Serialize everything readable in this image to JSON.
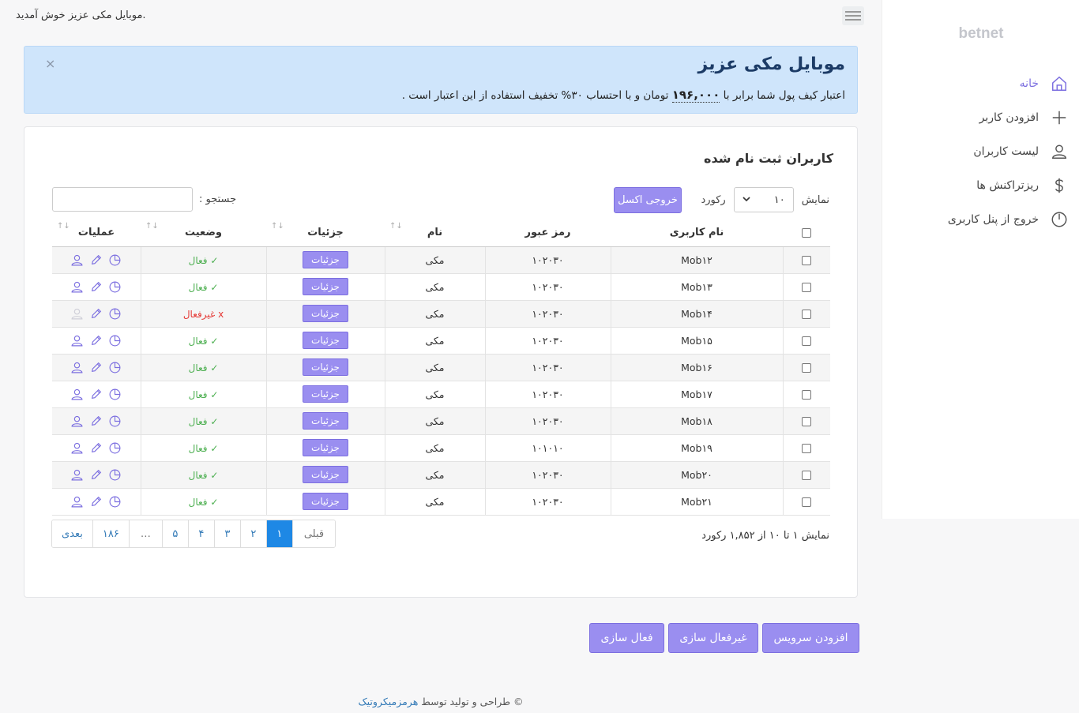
{
  "header": {
    "welcome": "موبایل مکی عزیز خوش آمدید."
  },
  "sidebar": {
    "brand": "betnet",
    "items": [
      {
        "label": "خانه",
        "icon": "home-icon"
      },
      {
        "label": "افزودن کاربر",
        "icon": "plus-icon"
      },
      {
        "label": "لیست کاربران",
        "icon": "user-icon"
      },
      {
        "label": "ریزتراکنش ها",
        "icon": "dollar-icon"
      },
      {
        "label": "خروج از پنل کاربری",
        "icon": "power-icon"
      }
    ]
  },
  "alert": {
    "title": "موبایل مکی عزیز",
    "text_before": "اعتبار کیف پول شما برابر با",
    "amount": "۱۹۶,۰۰۰",
    "text_after": "تومان و با احتساب ۳۰% تخفیف استفاده از این اعتبار است .",
    "close": "×"
  },
  "card": {
    "title": "کاربران ثبت نام شده",
    "show_label": "نمایش",
    "page_size": "۱۰",
    "records_label": "رکورد",
    "excel_label": "خروجی اکسل",
    "search_label": "جستجو :",
    "search_value": ""
  },
  "table": {
    "headers": {
      "username": "نام کاربری",
      "password": "رمز عبور",
      "name": "نام",
      "details": "جزئیات",
      "status": "وضعیت",
      "operations": "عملیات",
      "sort": "↓↑"
    },
    "detail_label": "جزئیات",
    "rows": [
      {
        "username": "Mob۱۲",
        "password": "۱۰۲۰۳۰",
        "name": "مکی",
        "status": "✓ فعال",
        "active": true
      },
      {
        "username": "Mob۱۳",
        "password": "۱۰۲۰۳۰",
        "name": "مکی",
        "status": "✓ فعال",
        "active": true
      },
      {
        "username": "Mob۱۴",
        "password": "۱۰۲۰۳۰",
        "name": "مکی",
        "status": "x غیرفعال",
        "active": false
      },
      {
        "username": "Mob۱۵",
        "password": "۱۰۲۰۳۰",
        "name": "مکی",
        "status": "✓ فعال",
        "active": true
      },
      {
        "username": "Mob۱۶",
        "password": "۱۰۲۰۳۰",
        "name": "مکی",
        "status": "✓ فعال",
        "active": true
      },
      {
        "username": "Mob۱۷",
        "password": "۱۰۲۰۳۰",
        "name": "مکی",
        "status": "✓ فعال",
        "active": true
      },
      {
        "username": "Mob۱۸",
        "password": "۱۰۲۰۳۰",
        "name": "مکی",
        "status": "✓ فعال",
        "active": true
      },
      {
        "username": "Mob۱۹",
        "password": "۱۰۱۰۱۰",
        "name": "مکی",
        "status": "✓ فعال",
        "active": true
      },
      {
        "username": "Mob۲۰",
        "password": "۱۰۲۰۳۰",
        "name": "مکی",
        "status": "✓ فعال",
        "active": true
      },
      {
        "username": "Mob۲۱",
        "password": "۱۰۲۰۳۰",
        "name": "مکی",
        "status": "✓ فعال",
        "active": true
      }
    ]
  },
  "pagination": {
    "info": "نمایش ۱ تا ۱۰ از ۱,۸۵۲ رکورد",
    "prev": "قبلی",
    "pages": [
      "۱",
      "۲",
      "۳",
      "۴",
      "۵",
      "…",
      "۱۸۶"
    ],
    "next": "بعدی",
    "current": "۱"
  },
  "actions": {
    "add_service": "افزودن سرویس",
    "deactivate": "غیرفعال سازی",
    "activate": "فعال سازی"
  },
  "footer": {
    "text": "© طراحی و تولید توسط",
    "link": "هرمزمیکروتیک"
  },
  "colors": {
    "accent": "#9a8ef0",
    "active_page": "#1e88e5",
    "alert_bg": "#cfe5fb",
    "success": "#4caf50",
    "danger": "#e53935"
  }
}
